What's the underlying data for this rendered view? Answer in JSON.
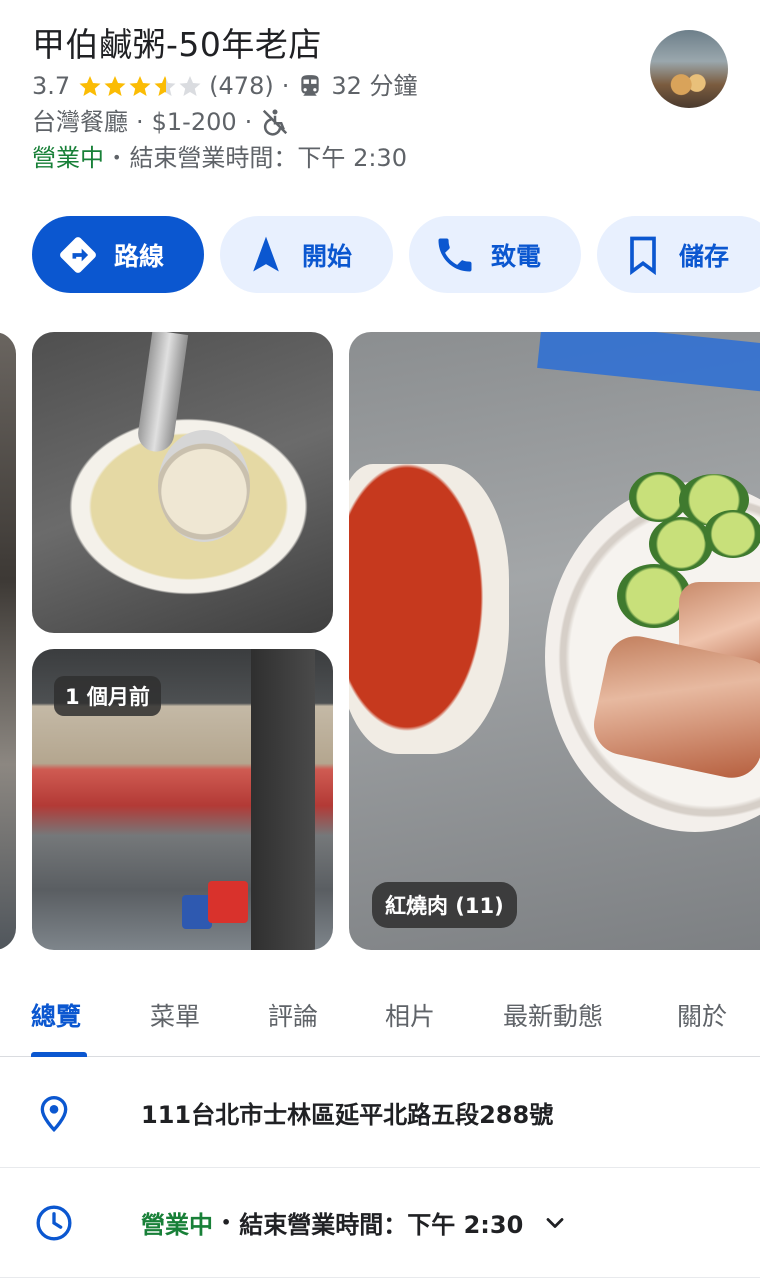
{
  "place": {
    "name": "甲伯鹹粥-50年老店",
    "rating": "3.7",
    "review_count": "(478)",
    "stars": 3.7,
    "transit_time": "32 分鐘",
    "category": "台灣餐廳",
    "price": "$1-200",
    "status": "營業中",
    "hours_text": "結束營業時間：下午 2:30"
  },
  "actions": {
    "route": "路線",
    "start": "開始",
    "call": "致電",
    "save": "儲存"
  },
  "photos": {
    "time_ago": "1 個月前",
    "pork_label": "紅燒肉 (11)"
  },
  "tabs": [
    "總覽",
    "菜單",
    "評論",
    "相片",
    "最新動態",
    "關於"
  ],
  "details": {
    "address": "111台北市士林區延平北路五段288號",
    "status": "營業中",
    "hours_text": "結束營業時間：下午 2:30"
  },
  "colors": {
    "accent": "#0b57d0",
    "open_green": "#188038",
    "star": "#fbbc04"
  }
}
